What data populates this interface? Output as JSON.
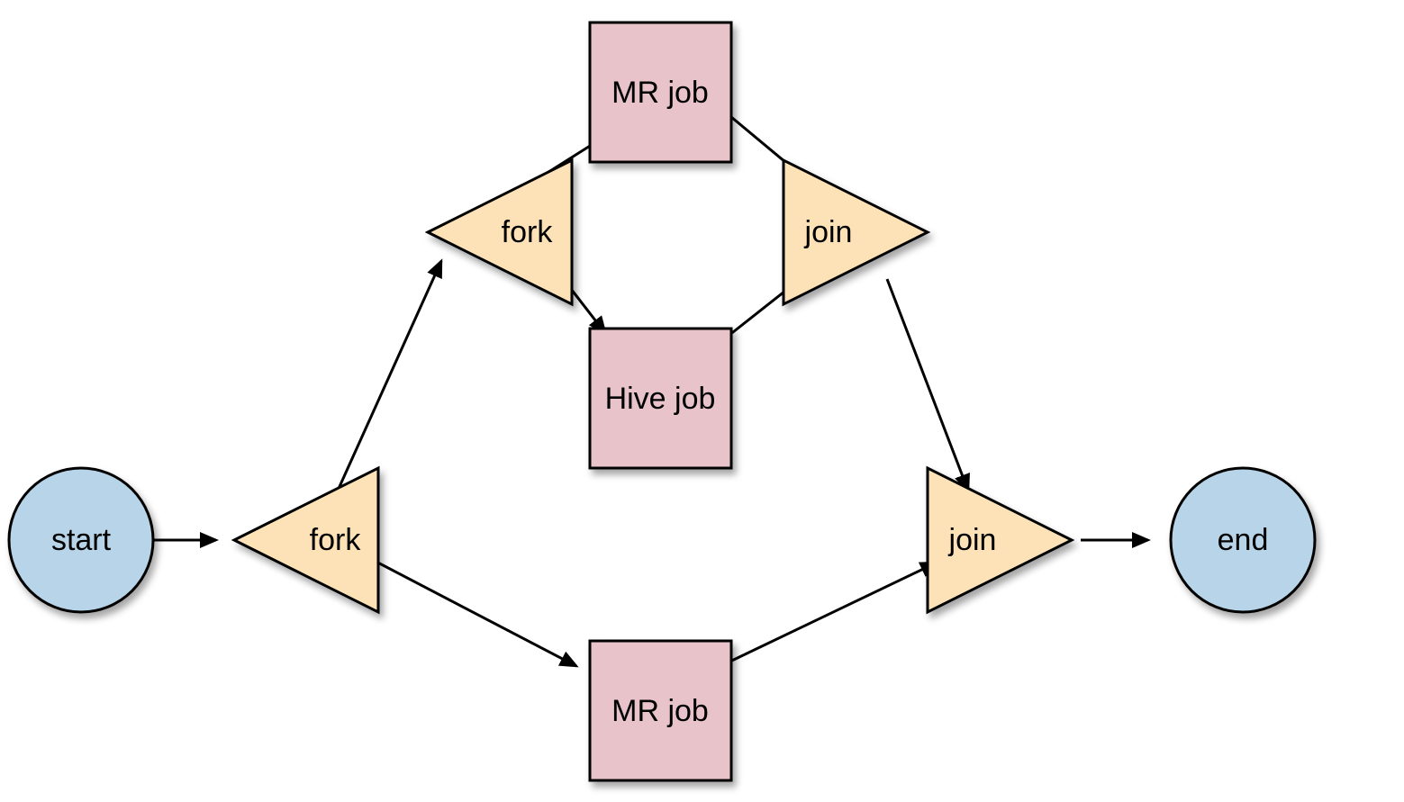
{
  "diagram": {
    "nodes": {
      "start": {
        "label": "start"
      },
      "fork1": {
        "label": "fork"
      },
      "fork2": {
        "label": "fork"
      },
      "mrjob1": {
        "label": "MR job"
      },
      "hivejob": {
        "label": "Hive job"
      },
      "mrjob2": {
        "label": "MR job"
      },
      "join1": {
        "label": "join"
      },
      "join2": {
        "label": "join"
      },
      "end": {
        "label": "end"
      }
    },
    "edges": [
      [
        "start",
        "fork1"
      ],
      [
        "fork1",
        "fork2"
      ],
      [
        "fork1",
        "mrjob2"
      ],
      [
        "fork2",
        "mrjob1"
      ],
      [
        "fork2",
        "hivejob"
      ],
      [
        "mrjob1",
        "join1"
      ],
      [
        "hivejob",
        "join1"
      ],
      [
        "join1",
        "join2"
      ],
      [
        "mrjob2",
        "join2"
      ],
      [
        "join2",
        "end"
      ]
    ],
    "colors": {
      "circle": "#b7d4e8",
      "triangle": "#fde2b8",
      "square": "#e8c4ca",
      "stroke": "#000000"
    }
  }
}
